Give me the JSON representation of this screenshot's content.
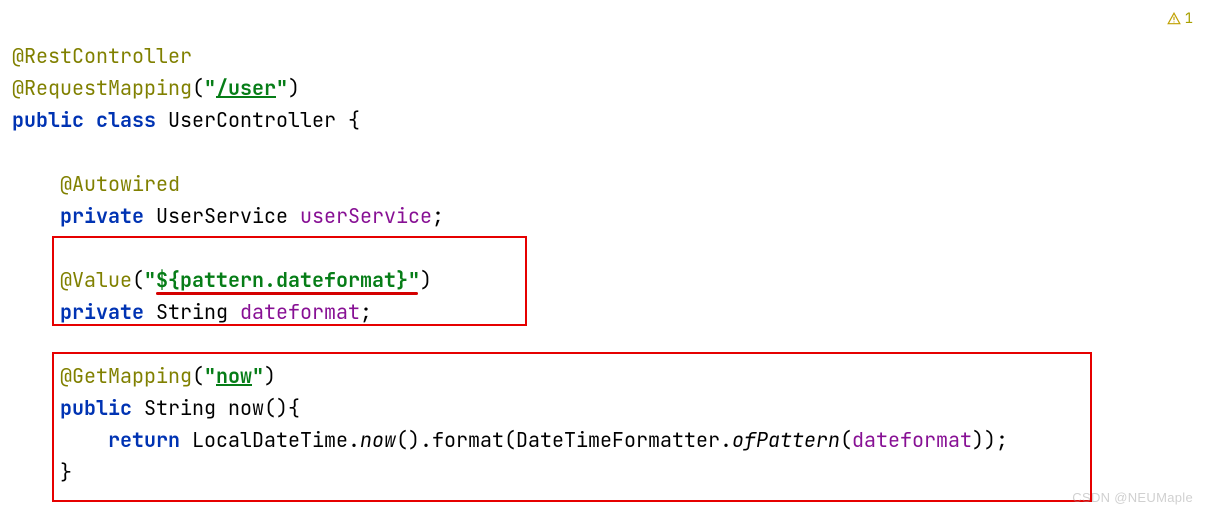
{
  "code": {
    "line1": {
      "annotation": "@RestController"
    },
    "line2": {
      "annotation": "@RequestMapping",
      "lparen": "(",
      "string_q1": "\"",
      "string_val": "/user",
      "string_q2": "\"",
      "rparen": ")"
    },
    "line3": {
      "kw1": "public",
      "kw2": "class",
      "classname": "UserController",
      "brace": "{"
    },
    "line5": {
      "annotation": "@Autowired"
    },
    "line6": {
      "kw": "private",
      "type": "UserService",
      "field": "userService",
      "semi": ";"
    },
    "line8": {
      "annotation": "@Value",
      "lparen": "(",
      "string_q1": "\"",
      "string_val": "${pattern.dateformat}",
      "string_q2": "\"",
      "rparen": ")"
    },
    "line9": {
      "kw": "private",
      "type": "String",
      "field": "dateformat",
      "semi": ";"
    },
    "line11": {
      "annotation": "@GetMapping",
      "lparen": "(",
      "string_q1": "\"",
      "string_val": "now",
      "string_q2": "\"",
      "rparen": ")"
    },
    "line12": {
      "kw": "public",
      "type": "String",
      "method": "now",
      "parens": "()",
      "brace": "{"
    },
    "line13": {
      "kw": "return",
      "cls1": "LocalDateTime",
      "dot1": ".",
      "m1": "now",
      "p1": "().",
      "m2": "format",
      "lp": "(",
      "cls2": "DateTimeFormatter",
      "dot2": ".",
      "m3": "ofPattern",
      "lp2": "(",
      "field": "dateformat",
      "rp": "));"
    },
    "line14": {
      "brace": "}"
    }
  },
  "warning": {
    "count": "1"
  },
  "watermark": "CSDN @NEUMaple"
}
